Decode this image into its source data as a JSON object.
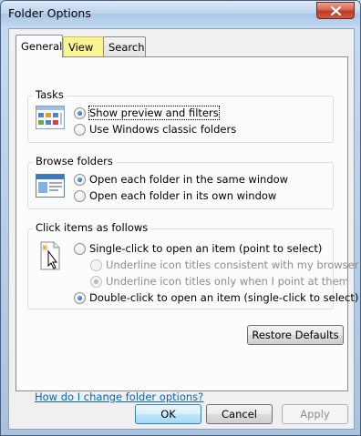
{
  "window": {
    "title": "Folder Options"
  },
  "tabs": [
    {
      "label": "General",
      "active": true
    },
    {
      "label": "View",
      "active": false
    },
    {
      "label": "Search",
      "active": false
    }
  ],
  "tasks": {
    "label": "Tasks",
    "icon": "folder-tasks-icon",
    "options": [
      {
        "label": "Show preview and filters",
        "checked": true
      },
      {
        "label": "Use Windows classic folders",
        "checked": false
      }
    ]
  },
  "browse": {
    "label": "Browse folders",
    "icon": "browse-window-icon",
    "options": [
      {
        "label": "Open each folder in the same window",
        "checked": true
      },
      {
        "label": "Open each folder in its own window",
        "checked": false
      }
    ]
  },
  "click": {
    "label": "Click items as follows",
    "icon": "pointer-click-icon",
    "options": [
      {
        "label": "Single-click to open an item (point to select)",
        "checked": false,
        "enabled": true
      },
      {
        "label": "Underline icon titles consistent with my browser",
        "checked": false,
        "enabled": false
      },
      {
        "label": "Underline icon titles only when I point at them",
        "checked": true,
        "enabled": false
      },
      {
        "label": "Double-click to open an item (single-click to select)",
        "checked": true,
        "enabled": true
      }
    ]
  },
  "buttons": {
    "restore": "Restore Defaults",
    "ok": "OK",
    "cancel": "Cancel",
    "apply": "Apply"
  },
  "help_link": "How do I change folder options?",
  "colors": {
    "link": "#0066cc",
    "view_tab_highlight": "#fbf490",
    "close_button": "#c03a22"
  }
}
